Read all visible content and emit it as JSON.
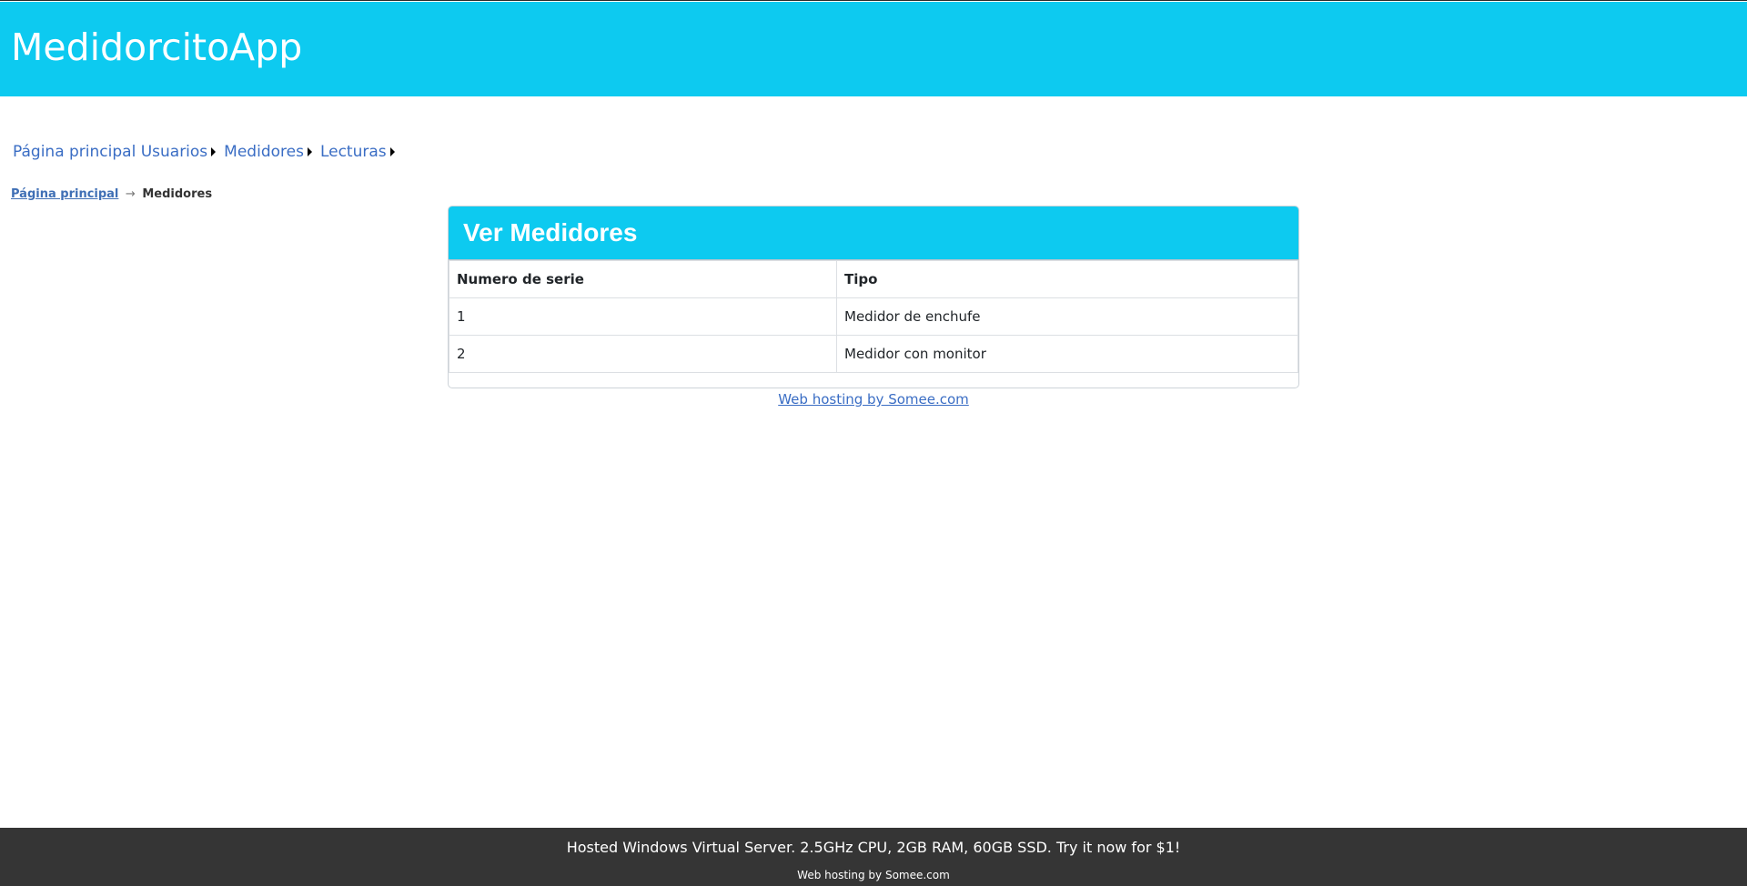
{
  "header": {
    "app_title": "MedidorcitoApp",
    "background": "#0dcaf0"
  },
  "menu": {
    "items": [
      {
        "label": "Página principal"
      },
      {
        "label": "Usuarios"
      },
      {
        "label": "Medidores"
      },
      {
        "label": "Lecturas"
      }
    ]
  },
  "breadcrumb": {
    "home_label": "Página principal",
    "separator": "→",
    "current_label": "Medidores"
  },
  "card": {
    "title": "Ver Medidores",
    "table": {
      "columns": [
        "Numero de serie",
        "Tipo"
      ],
      "rows": [
        [
          "1",
          "Medidor de enchufe"
        ],
        [
          "2",
          "Medidor con monitor"
        ]
      ]
    }
  },
  "hosting_link": "Web hosting by Somee.com",
  "footer": {
    "ad_text": "Hosted Windows Virtual Server. 2.5GHz CPU, 2GB RAM, 60GB SSD. Try it now for $1!",
    "link_text": "Web hosting by Somee.com",
    "background": "#353535"
  }
}
